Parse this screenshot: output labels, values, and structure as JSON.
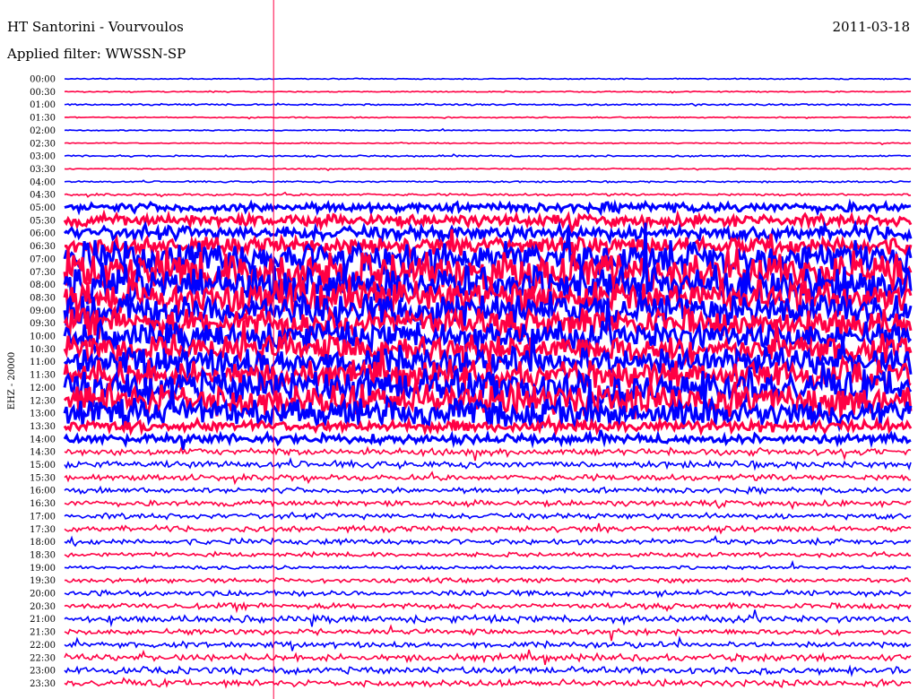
{
  "header": {
    "station": "HT Santorini - Vourvoulos",
    "filter": "Applied filter: WWSSN-SP",
    "date": "2011-03-18"
  },
  "chart_data": {
    "type": "line",
    "title": "HT Santorini - Vourvoulos",
    "subtitle": "Applied filter: WWSSN-SP",
    "date": "2011-03-18",
    "ylabel": "EHZ - 20000",
    "trace_colors": [
      "#0000ff",
      "#ff0044"
    ],
    "marker_color": "#ff0044",
    "marker_position_fraction": 0.247,
    "time_span_minutes_per_trace": 30,
    "row_labels": [
      "00:00",
      "00:30",
      "01:00",
      "01:30",
      "02:00",
      "02:30",
      "03:00",
      "03:30",
      "04:00",
      "04:30",
      "05:00",
      "05:30",
      "06:00",
      "06:30",
      "07:00",
      "07:30",
      "08:00",
      "08:30",
      "09:00",
      "09:30",
      "10:00",
      "10:30",
      "11:00",
      "11:30",
      "12:00",
      "12:30",
      "13:00",
      "13:30",
      "14:00",
      "14:30",
      "15:00",
      "15:30",
      "16:00",
      "16:30",
      "17:00",
      "17:30",
      "18:00",
      "18:30",
      "19:00",
      "19:30",
      "20:00",
      "20:30",
      "21:00",
      "21:30",
      "22:00",
      "22:30",
      "23:00",
      "23:30"
    ],
    "relative_amplitude": [
      0.1,
      0.1,
      0.15,
      0.1,
      0.1,
      0.1,
      0.15,
      0.1,
      0.15,
      0.2,
      0.8,
      1.0,
      1.2,
      1.5,
      3.0,
      3.5,
      3.5,
      3.0,
      3.0,
      2.5,
      2.5,
      2.5,
      2.5,
      2.5,
      3.0,
      3.0,
      2.5,
      1.0,
      0.8,
      0.6,
      0.6,
      0.5,
      0.5,
      0.5,
      0.5,
      0.5,
      0.5,
      0.4,
      0.3,
      0.4,
      0.5,
      0.5,
      0.6,
      0.5,
      0.5,
      0.6,
      0.6,
      0.6
    ],
    "grid": false
  }
}
